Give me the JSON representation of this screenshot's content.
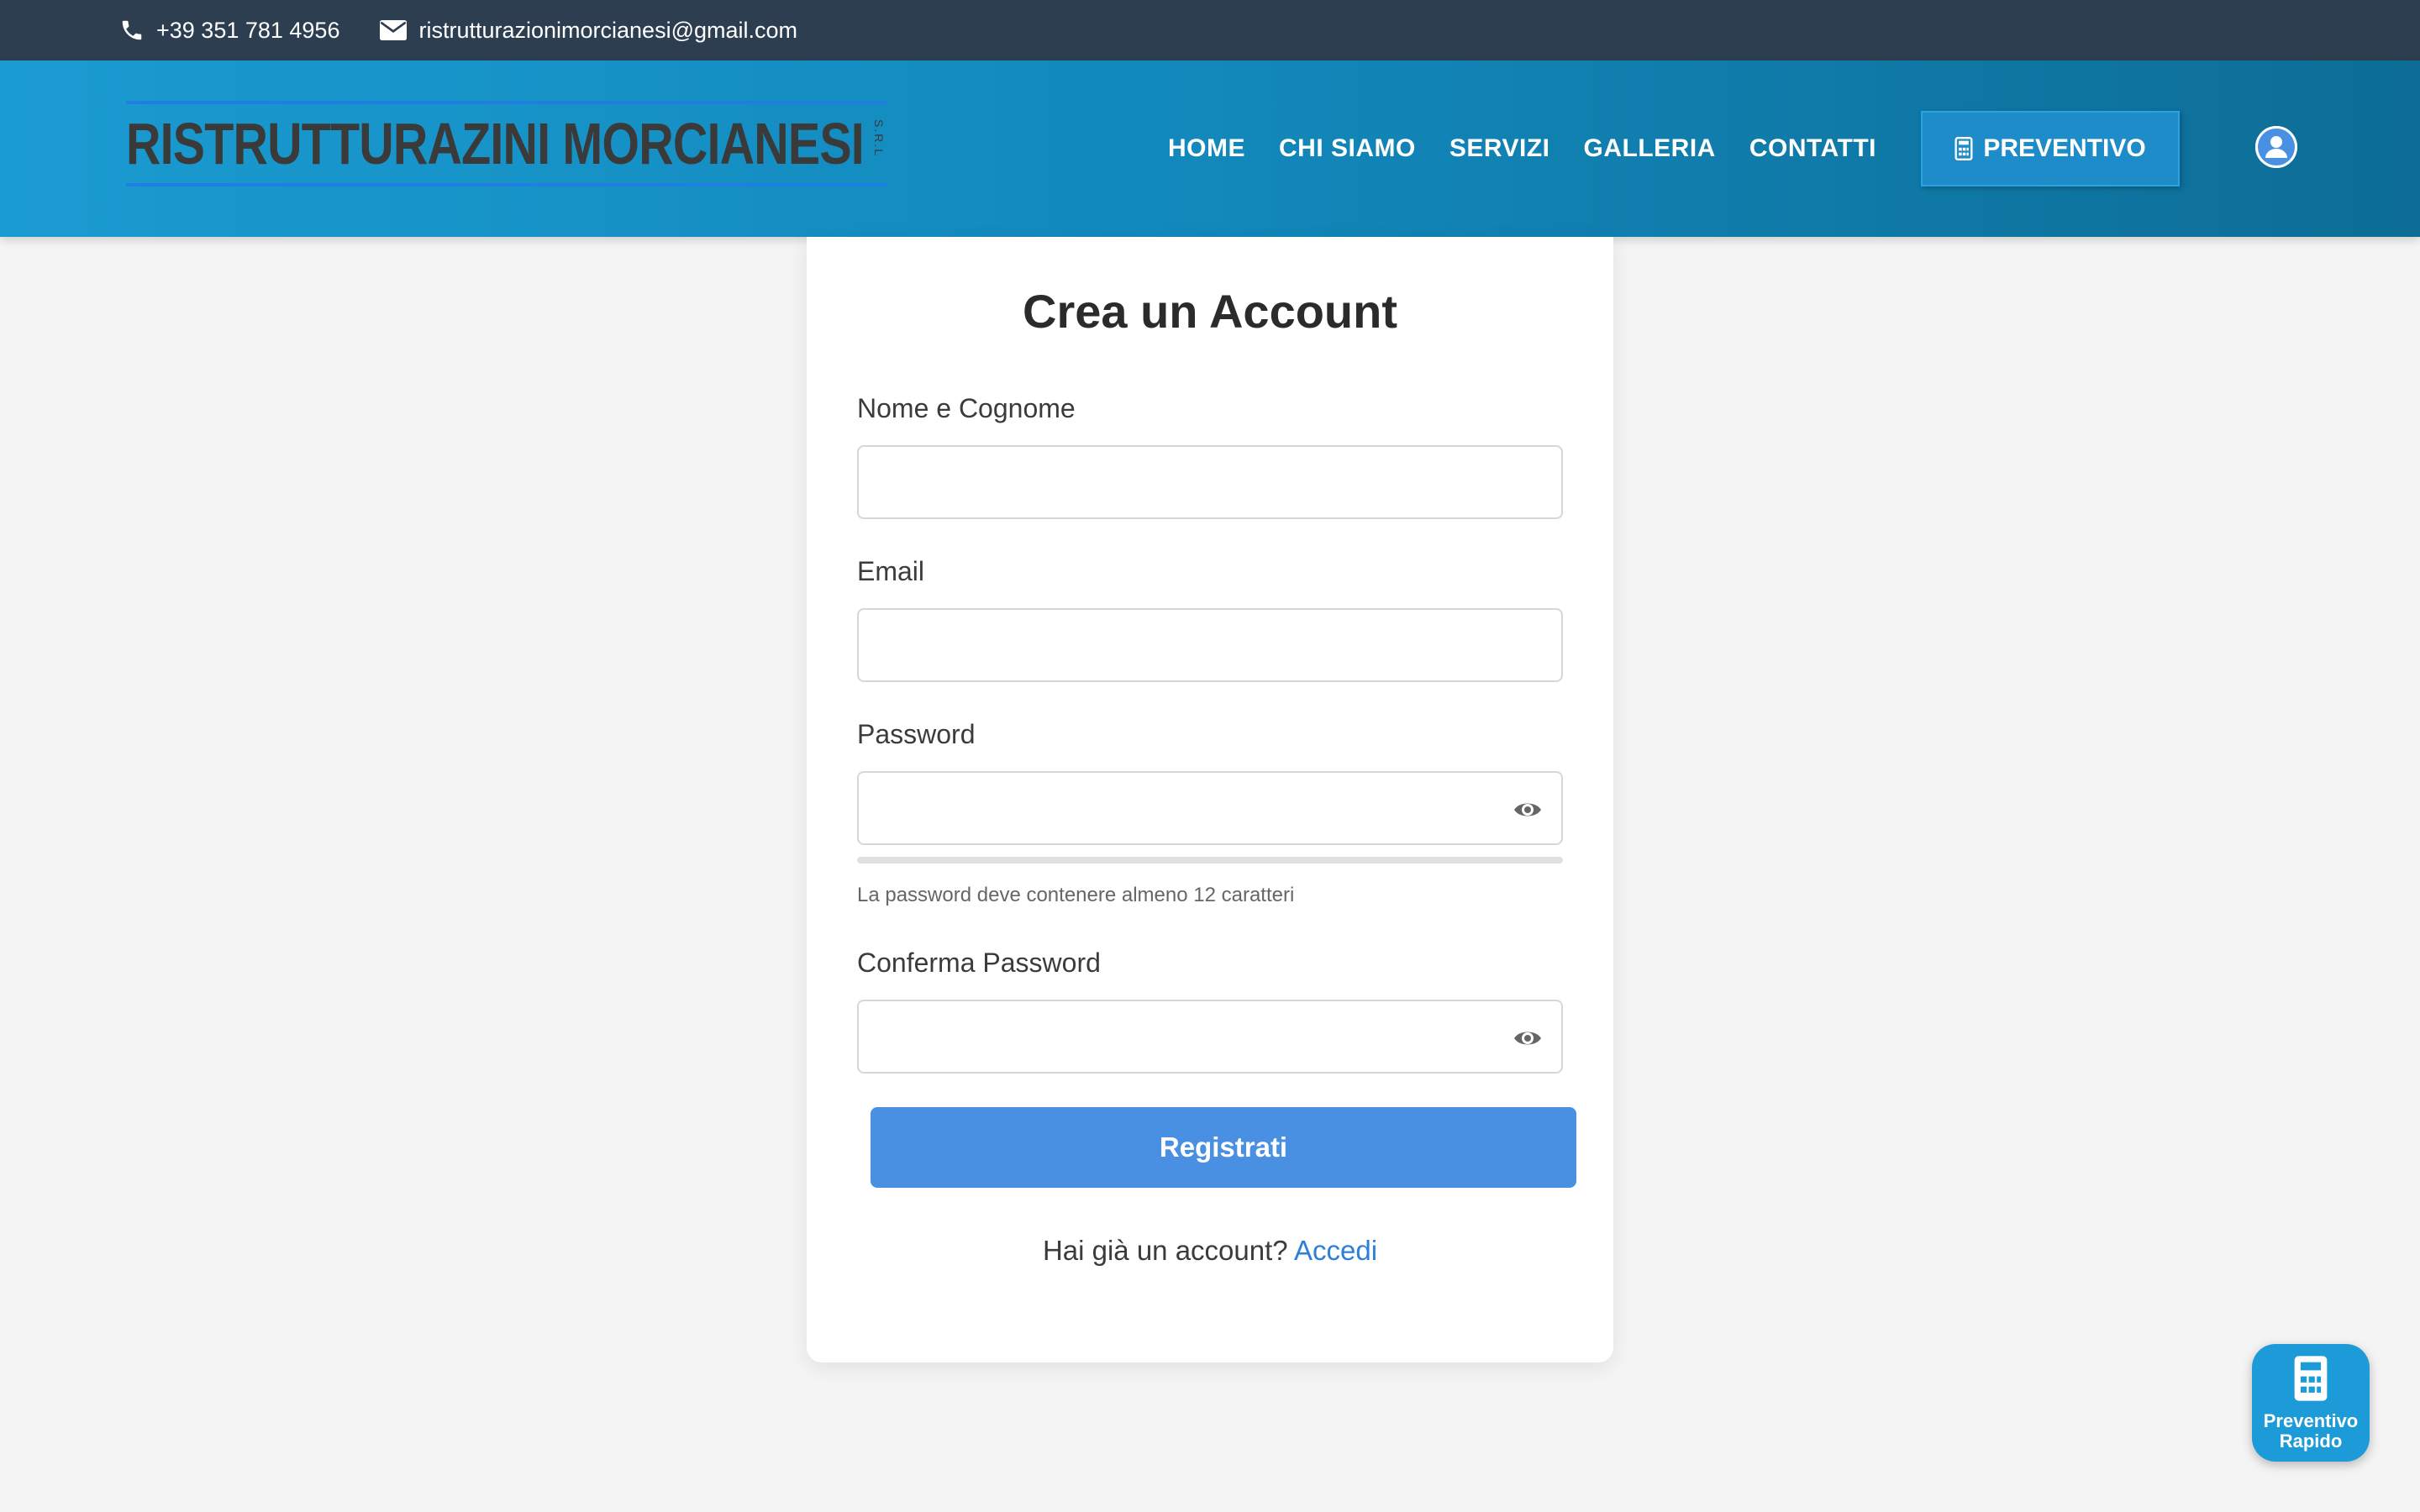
{
  "topbar": {
    "phone": "+39 351 781 4956",
    "email": "ristrutturazionimorcianesi@gmail.com"
  },
  "header": {
    "logo_text": "RISTRUTTURAZINI MORCIANESI",
    "logo_suffix": "S.R.L",
    "nav": [
      "HOME",
      "CHI SIAMO",
      "SERVIZI",
      "GALLERIA",
      "CONTATTI"
    ],
    "cta_label": "PREVENTIVO"
  },
  "form": {
    "title": "Crea un Account",
    "name_label": "Nome e Cognome",
    "name_value": "",
    "email_label": "Email",
    "email_value": "",
    "password_label": "Password",
    "password_value": "",
    "password_hint": "La password deve contenere almeno 12 caratteri",
    "password_strength": 0,
    "confirm_label": "Conferma Password",
    "confirm_value": "",
    "submit_label": "Registrati",
    "login_prompt": "Hai già un account?",
    "login_link": "Accedi"
  },
  "fab": {
    "line1": "Preventivo",
    "line2": "Rapido"
  },
  "colors": {
    "topbar": "#2c3e50",
    "header": "#1a9bd1",
    "primary_button": "#4a90e2",
    "link": "#2d7fd8",
    "background": "#f4f4f4"
  }
}
